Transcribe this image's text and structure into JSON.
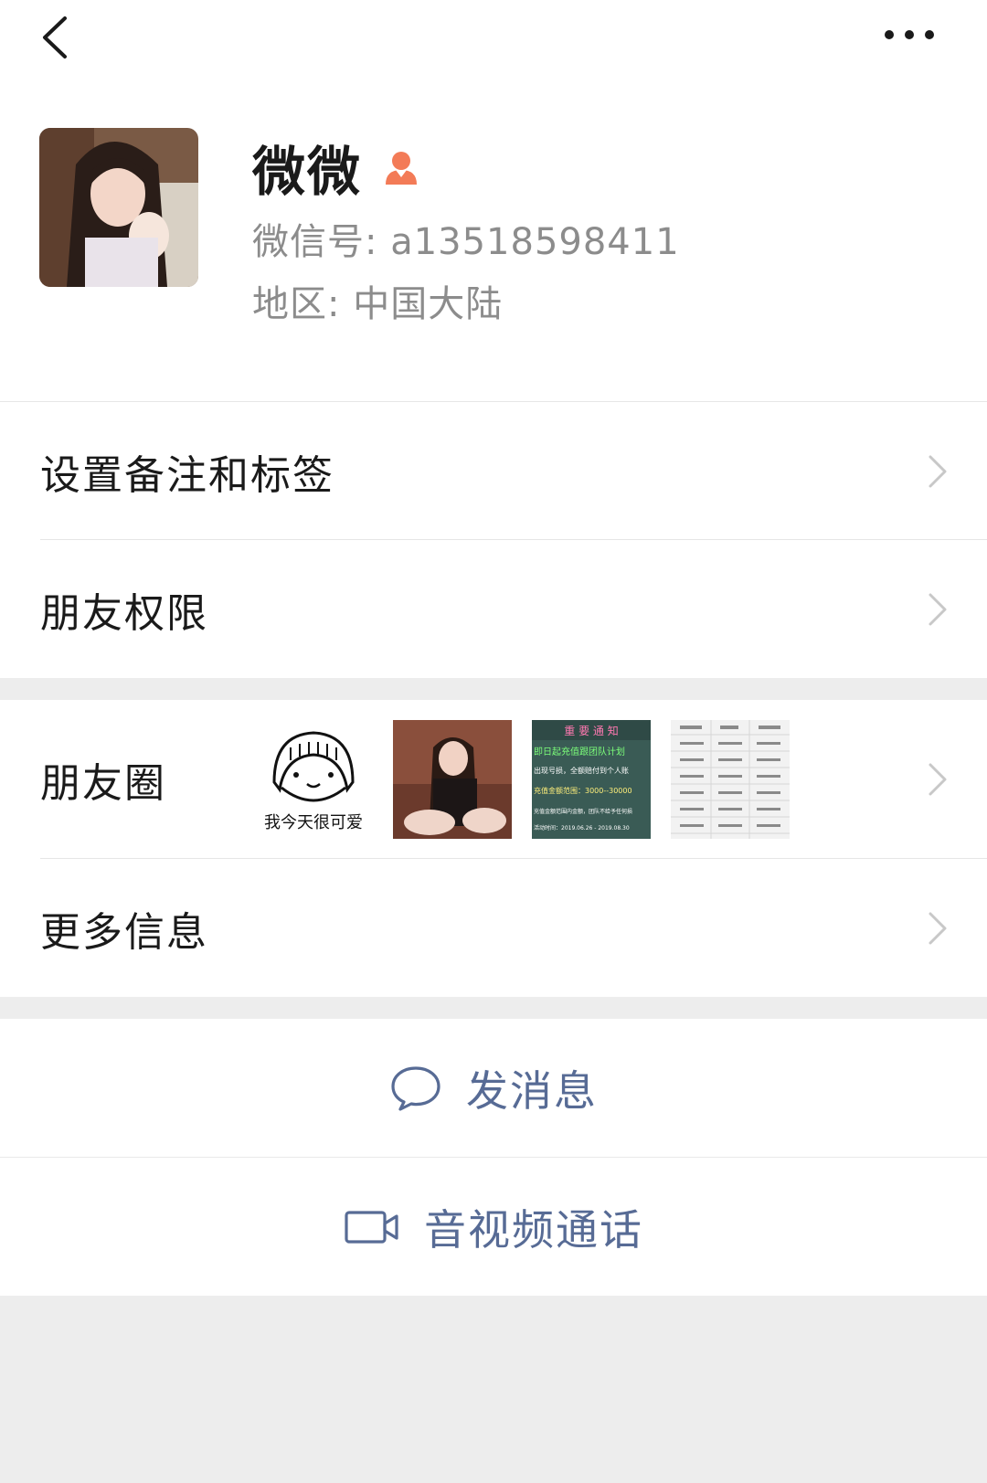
{
  "colors": {
    "background": "#ededed",
    "surface": "#ffffff",
    "primary_text": "#1a1a1a",
    "secondary_text": "#8c8c8c",
    "link_blue": "#576b95",
    "gender_female": "#f37b57"
  },
  "topbar": {
    "back_icon": "chevron-left-icon",
    "more_icon": "more-dots-icon"
  },
  "profile": {
    "name": "微微",
    "gender_icon": "female-icon",
    "wxid": "微信号:  a13518598411",
    "region": "地区:  中国大陆"
  },
  "group1": {
    "items": [
      {
        "label": "设置备注和标签",
        "icon": "chevron-right-icon"
      },
      {
        "label": "朋友权限",
        "icon": "chevron-right-icon"
      }
    ]
  },
  "group2": {
    "moments_label": "朋友圈",
    "moments_thumbs": [
      {
        "kind": "sketch",
        "caption": "我今天很可爱"
      },
      {
        "kind": "photo"
      },
      {
        "kind": "notice",
        "lines": [
          "重 要 通 知",
          "即日起充值跟团队计划",
          "出现号损，全额赔付到个人账",
          "充值金额范围：3000--30000",
          "充值金额范围内金额，团队不给予任何损",
          "活动时间：2019.06.26 - 2019.08.30"
        ]
      },
      {
        "kind": "table"
      }
    ],
    "more_info_label": "更多信息"
  },
  "actions": {
    "message_label": "发消息",
    "message_icon": "chat-bubble-icon",
    "call_label": "音视频通话",
    "call_icon": "video-camera-icon"
  }
}
